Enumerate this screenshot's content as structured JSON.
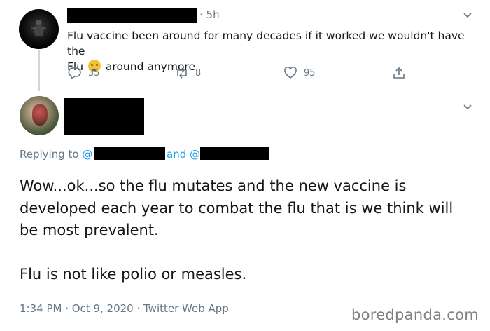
{
  "tweet1": {
    "time": "· 5h",
    "text_part1": "Flu vaccine been around for many decades if it worked we wouldn't have the",
    "text_part2_before": "Flu",
    "emoji": "face-with-thermometer-emoji",
    "text_part2_after": "around anymore",
    "actions": {
      "reply_count": "35",
      "retweet_count": "8",
      "like_count": "95"
    }
  },
  "tweet2": {
    "replying_prefix": "Replying to",
    "at1": "@",
    "and_text": "and @",
    "text_paragraph1": "Wow...ok...so the flu mutates and the new vaccine is developed each year to combat the flu that is we think will be most prevalent.",
    "text_paragraph2": "Flu is not like polio or measles.",
    "meta": "1:34 PM · Oct 9, 2020 · Twitter Web App"
  },
  "watermark": "boredpanda.com",
  "colors": {
    "accent": "#1da1f2",
    "muted": "#657786",
    "text": "#14171a",
    "redaction": "#000000"
  }
}
